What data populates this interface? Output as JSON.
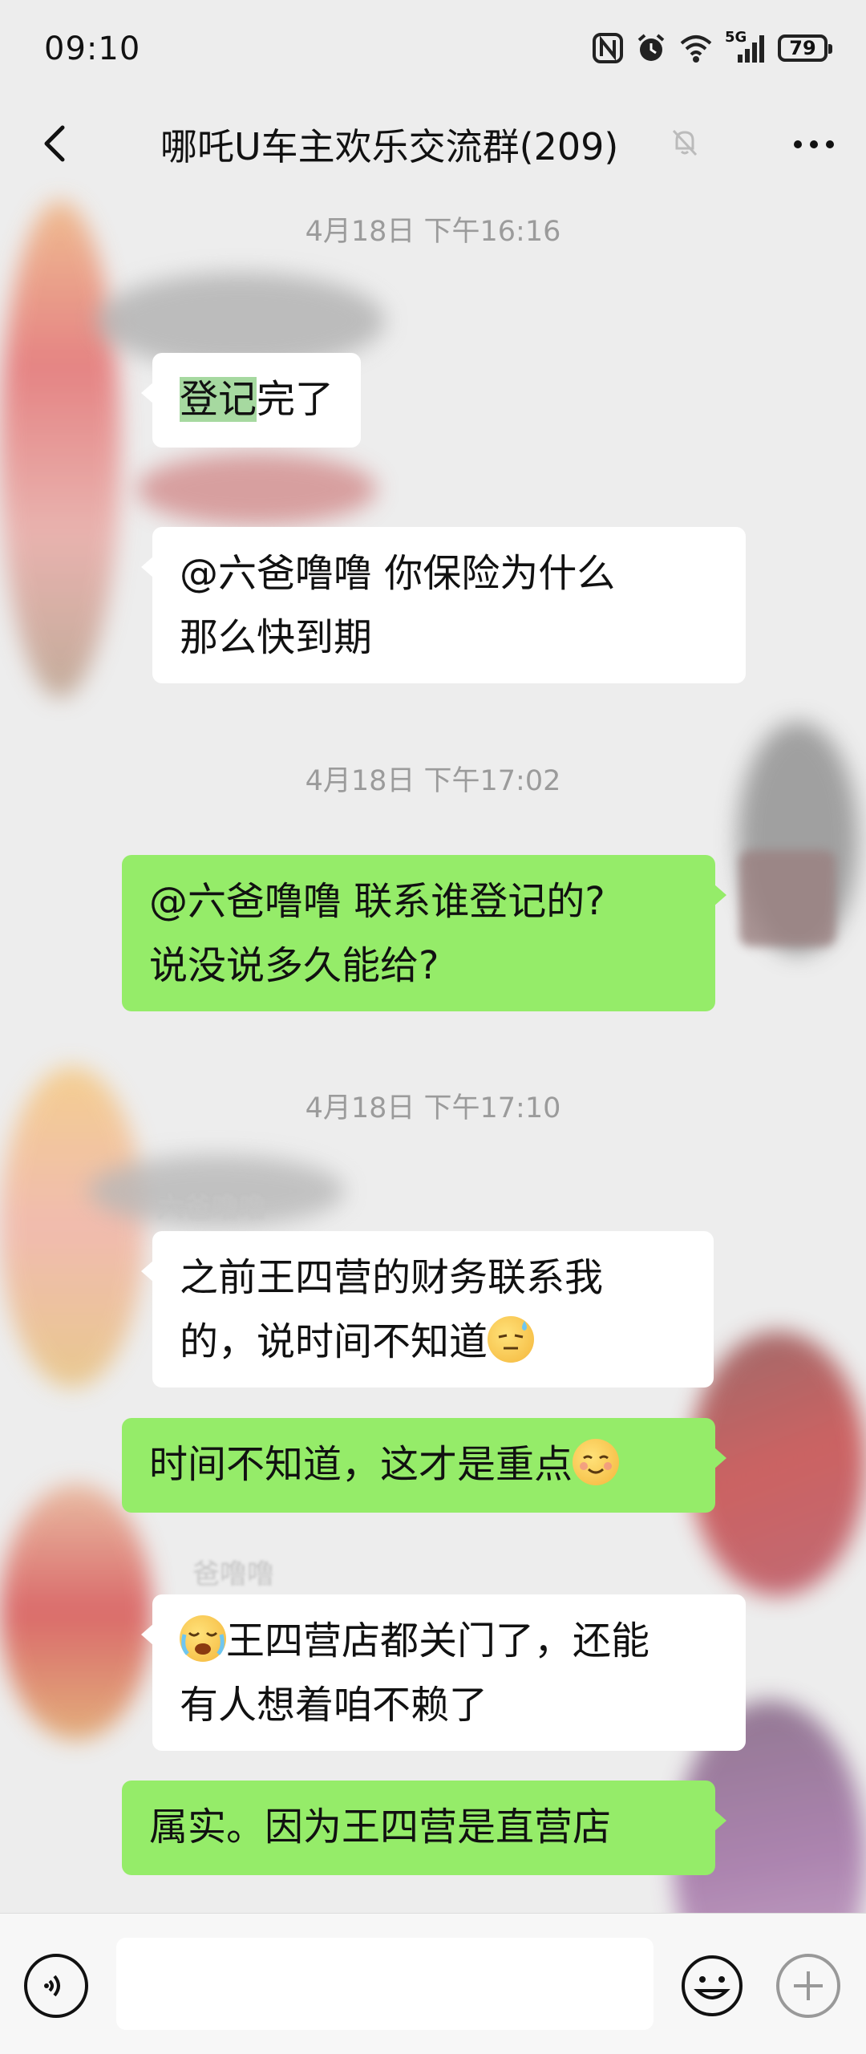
{
  "status_bar": {
    "time": "09:10",
    "network": "5G",
    "battery": "79"
  },
  "nav": {
    "title": "哪吒U车主欢乐交流群(209)"
  },
  "messages": [
    {
      "type": "time",
      "text": "4月18日 下午16:16"
    },
    {
      "type": "in",
      "highlight": "登记",
      "text": "完了"
    },
    {
      "type": "in",
      "line1": "@六爸噜噜  你保险为什么",
      "line2": "那么快到期"
    },
    {
      "type": "time",
      "text": "4月18日 下午17:02"
    },
    {
      "type": "out",
      "line1": "@六爸噜噜  联系谁登记的?",
      "line2": "说没说多久能给?"
    },
    {
      "type": "time",
      "text": "4月18日 下午17:10"
    },
    {
      "type": "sender",
      "name": "六爸噜噜"
    },
    {
      "type": "in",
      "line1": "之前王四营的财务联系我",
      "line2": "的，说时间不知道",
      "emoji": "sweat-face"
    },
    {
      "type": "out",
      "text": "时间不知道，这才是重点",
      "emoji": "smiling-face"
    },
    {
      "type": "sender",
      "name": "爸噜噜"
    },
    {
      "type": "in",
      "emoji": "crying-face",
      "line1": "王四营店都关门了，还能",
      "line2": "有人想着咱不赖了"
    },
    {
      "type": "out",
      "text": "属实。因为王四营是直营店"
    }
  ],
  "colors": {
    "background": "#ededed",
    "outgoing": "#95ec69",
    "incoming": "#ffffff",
    "timestamp": "#9b9b9b"
  }
}
